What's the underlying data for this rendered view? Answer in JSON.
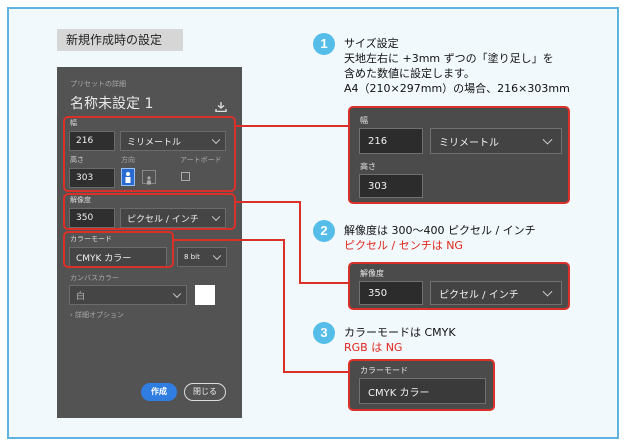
{
  "heading": "新規作成時の設定",
  "panel": {
    "preset_label": "プリセットの詳細",
    "doc_name": "名称未設定 1",
    "width_label": "幅",
    "width_value": "216",
    "unit_value": "ミリメートル",
    "height_label": "高さ",
    "height_value": "303",
    "orientation_label": "方向",
    "artboard_label": "アートボード",
    "resolution_label": "解像度",
    "resolution_value": "350",
    "resolution_unit": "ピクセル / インチ",
    "color_mode_label": "カラーモード",
    "color_mode_value": "CMYK カラー",
    "bit_value": "8 bit",
    "canvas_color_label": "カンバスカラー",
    "canvas_color_value": "白",
    "advanced_label": "詳細オプション",
    "create_button": "作成",
    "close_button": "閉じる"
  },
  "notes": [
    {
      "num": "1",
      "lines": [
        "サイズ設定",
        "天地左右に +3mm ずつの「塗り足し」を",
        "含めた数値に設定します。",
        "A4（210×297mm）の場合、216×303mm"
      ]
    },
    {
      "num": "2",
      "lines": [
        "解像度は 300〜400 ピクセル / インチ"
      ],
      "warning": "ピクセル / センチは NG"
    },
    {
      "num": "3",
      "lines": [
        "カラーモードは CMYK"
      ],
      "warning": "RGB は NG"
    }
  ],
  "zoom_size": {
    "width_label": "幅",
    "width_value": "216",
    "unit_value": "ミリメートル",
    "height_label": "高さ",
    "height_value": "303"
  },
  "zoom_resolution": {
    "label": "解像度",
    "value": "350",
    "unit": "ピクセル / インチ"
  },
  "zoom_color": {
    "label": "カラーモード",
    "value": "CMYK カラー"
  },
  "colors": {
    "frame_border": "#5fb4df",
    "frame_bg": "#f2f9fd",
    "panel_bg": "#535353",
    "highlight": "#d9302a",
    "badge": "#55bde8",
    "create_button": "#2f7de1"
  }
}
